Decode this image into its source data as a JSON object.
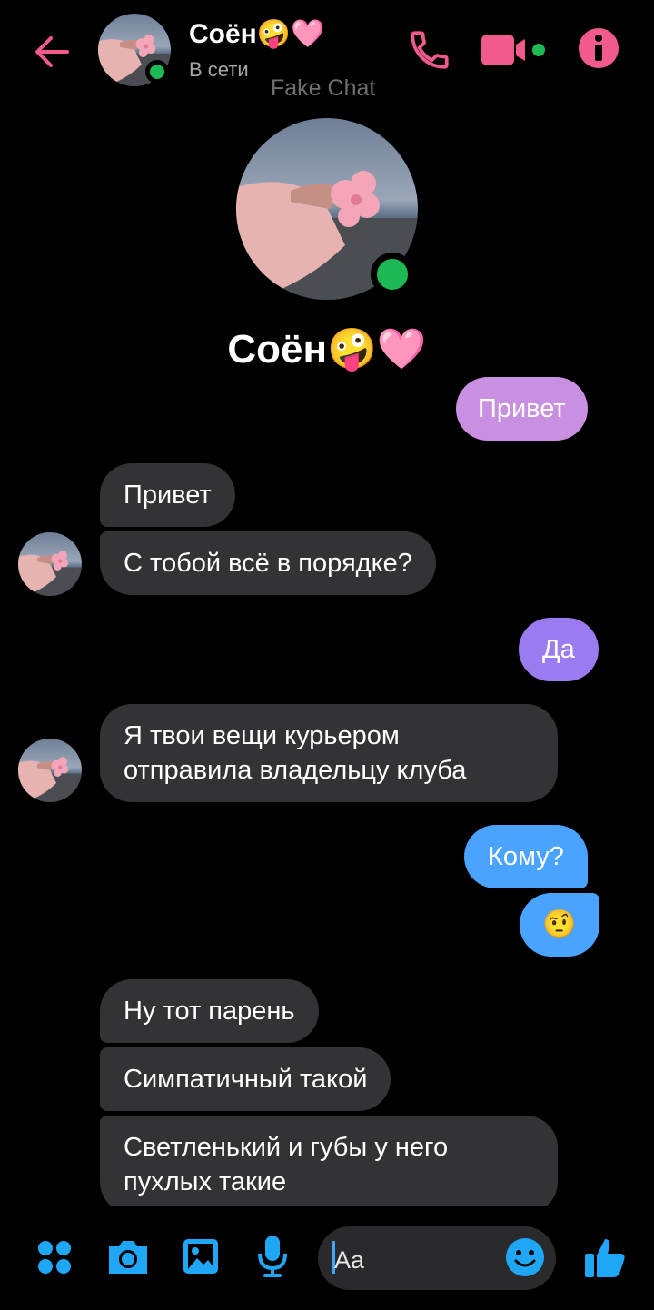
{
  "header": {
    "contact_name": "Соён🤪🩷",
    "status": "В сети",
    "watermark": "Fake Chat"
  },
  "profile": {
    "name": "Соён🤪🩷"
  },
  "colors": {
    "accent_pink": "#f05a8c",
    "online_green": "#1db954",
    "incoming_bubble": "#333336",
    "outgoing_lilac": "#c98fe0",
    "outgoing_violet": "#9a7cf0",
    "outgoing_blue": "#4aa3ff",
    "icon_blue": "#1fa7f5"
  },
  "messages": [
    {
      "dir": "out",
      "text": "Привет"
    },
    {
      "dir": "in",
      "text": "Привет"
    },
    {
      "dir": "in",
      "text": "С тобой всё в порядке?"
    },
    {
      "dir": "out",
      "text": "Да"
    },
    {
      "dir": "in",
      "text": "Я твои вещи курьером отправила владельцу клуба"
    },
    {
      "dir": "out",
      "text": "Кому?"
    },
    {
      "dir": "out",
      "text": "🤨"
    },
    {
      "dir": "in",
      "text": "Ну тот парень"
    },
    {
      "dir": "in",
      "text": "Симпатичный такой"
    },
    {
      "dir": "in",
      "text": "Светленький и губы у него пухлых такие"
    }
  ],
  "composer": {
    "placeholder": "Aa",
    "icons": [
      "apps-icon",
      "camera-icon",
      "gallery-icon",
      "microphone-icon",
      "emoji-icon",
      "like-icon"
    ]
  }
}
